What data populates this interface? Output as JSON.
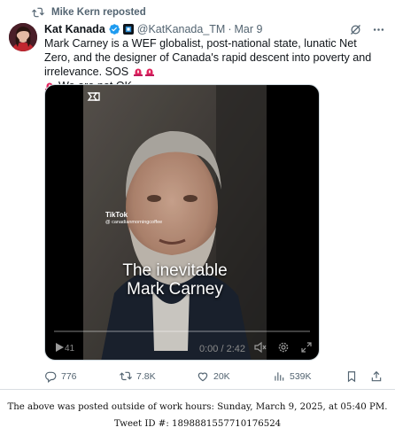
{
  "repost": {
    "label": "Mike Kern reposted"
  },
  "tweet": {
    "display_name": "Kat Kanada",
    "handle": "@KatKanada_TM",
    "separator": "·",
    "date": "Mar 9",
    "text_main": "Mark Carney is a WEF globalist, post-national state, lunatic Net Zero, and the designer of Canada's rapid descent into poverty and irrelevance. SOS",
    "text_tail": "We are not OK."
  },
  "video": {
    "tiktok_label": "TikTok",
    "tiktok_user": "@ canadianmorningcoffee",
    "caption_line1": "The inevitable",
    "caption_line2": "Mark Carney",
    "replay_time": "41",
    "current_time": "0:00",
    "time_separator": " / ",
    "duration": "2:42",
    "progress": 0
  },
  "actions": {
    "replies": "776",
    "reposts": "7.8K",
    "likes": "20K",
    "views": "539K"
  },
  "footer": {
    "line1": "The above was posted outside of work hours: Sunday, March 9, 2025, at 05:40 PM.",
    "line2": "Tweet ID #: 1898881557710176524"
  },
  "colors": {
    "verified": "#1d9bf0",
    "secondary_text": "#536471",
    "siren": "#e0245e"
  },
  "icons": [
    "repost-icon",
    "verified-badge-icon",
    "affiliate-badge-icon",
    "grok-icon",
    "more-icon",
    "siren-icon",
    "capcut-icon",
    "play-icon",
    "mute-icon",
    "settings-icon",
    "fullscreen-icon",
    "reply-icon",
    "retweet-icon",
    "like-icon",
    "views-icon",
    "bookmark-icon",
    "share-icon"
  ]
}
